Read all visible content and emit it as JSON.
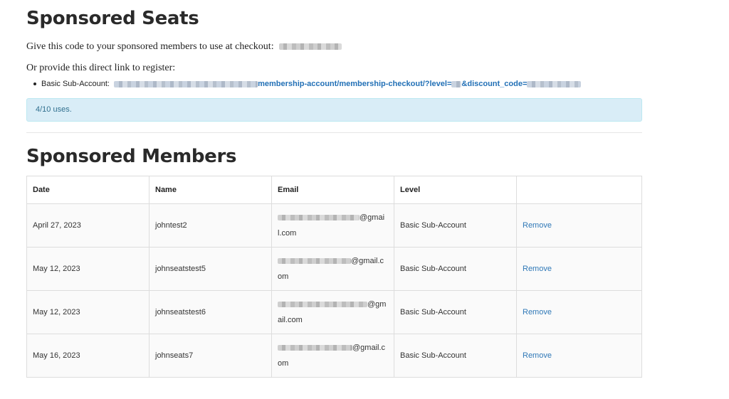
{
  "seats": {
    "title": "Sponsored Seats",
    "code_prompt": "Give this code to your sponsored members to use at checkout:",
    "link_prompt": "Or provide this direct link to register:",
    "link_item_label": "Basic Sub-Account:",
    "link_path_1": "membership-account/membership-checkout/?level=",
    "link_path_2": "&discount_code=",
    "uses": "4/10 uses."
  },
  "members": {
    "title": "Sponsored Members",
    "headers": [
      "Date",
      "Name",
      "Email",
      "Level",
      ""
    ],
    "rows": [
      {
        "date": "April 27, 2023",
        "name": "johntest2",
        "email_tail1": "@gmai",
        "email_tail2": "l.com",
        "level": "Basic Sub-Account",
        "action": "Remove"
      },
      {
        "date": "May 12, 2023",
        "name": "johnseatstest5",
        "email_tail1": "@gmail.c",
        "email_tail2": "om",
        "level": "Basic Sub-Account",
        "action": "Remove"
      },
      {
        "date": "May 12, 2023",
        "name": "johnseatstest6",
        "email_tail1": "@gm",
        "email_tail2": "ail.com",
        "level": "Basic Sub-Account",
        "action": "Remove"
      },
      {
        "date": "May 16, 2023",
        "name": "johnseats7",
        "email_tail1": "@gmail.c",
        "email_tail2": "om",
        "level": "Basic Sub-Account",
        "action": "Remove"
      }
    ]
  },
  "colors": {
    "link": "#2270b6",
    "notice_bg": "#d9edf7",
    "notice_text": "#31708f"
  }
}
